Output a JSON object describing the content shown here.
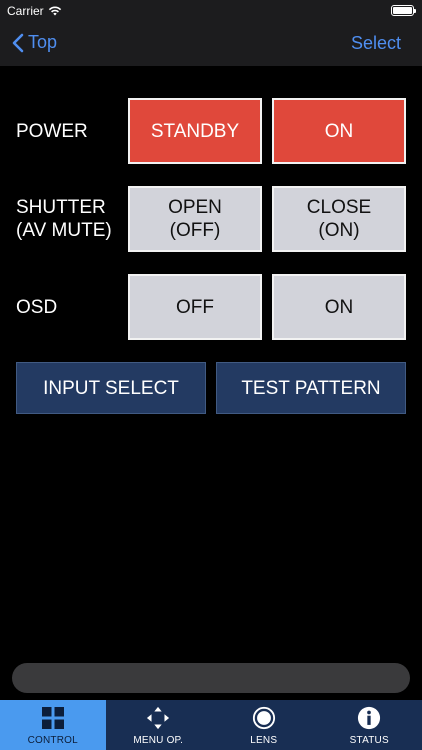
{
  "status_bar": {
    "carrier": "Carrier"
  },
  "nav": {
    "back_label": "Top",
    "select_label": "Select"
  },
  "rows": {
    "power": {
      "label": "POWER",
      "btn1": "STANDBY",
      "btn2": "ON"
    },
    "shutter": {
      "label_line1": "SHUTTER",
      "label_line2": "(AV MUTE)",
      "open_line1": "OPEN",
      "open_line2": "(OFF)",
      "close_line1": "CLOSE",
      "close_line2": "(ON)"
    },
    "osd": {
      "label": "OSD",
      "btn1": "OFF",
      "btn2": "ON"
    }
  },
  "actions": {
    "input_select": "INPUT SELECT",
    "test_pattern": "TEST PATTERN"
  },
  "tabs": [
    {
      "label": "CONTROL",
      "icon": "grid-icon"
    },
    {
      "label": "MENU OP.",
      "icon": "arrows-icon"
    },
    {
      "label": "LENS",
      "icon": "lens-icon"
    },
    {
      "label": "STATUS",
      "icon": "info-icon"
    }
  ],
  "colors": {
    "accent": "#4f8ef0",
    "red": "#e0483b",
    "grey": "#d2d3da",
    "navy": "#233a62",
    "tab_active": "#4a9aef"
  }
}
